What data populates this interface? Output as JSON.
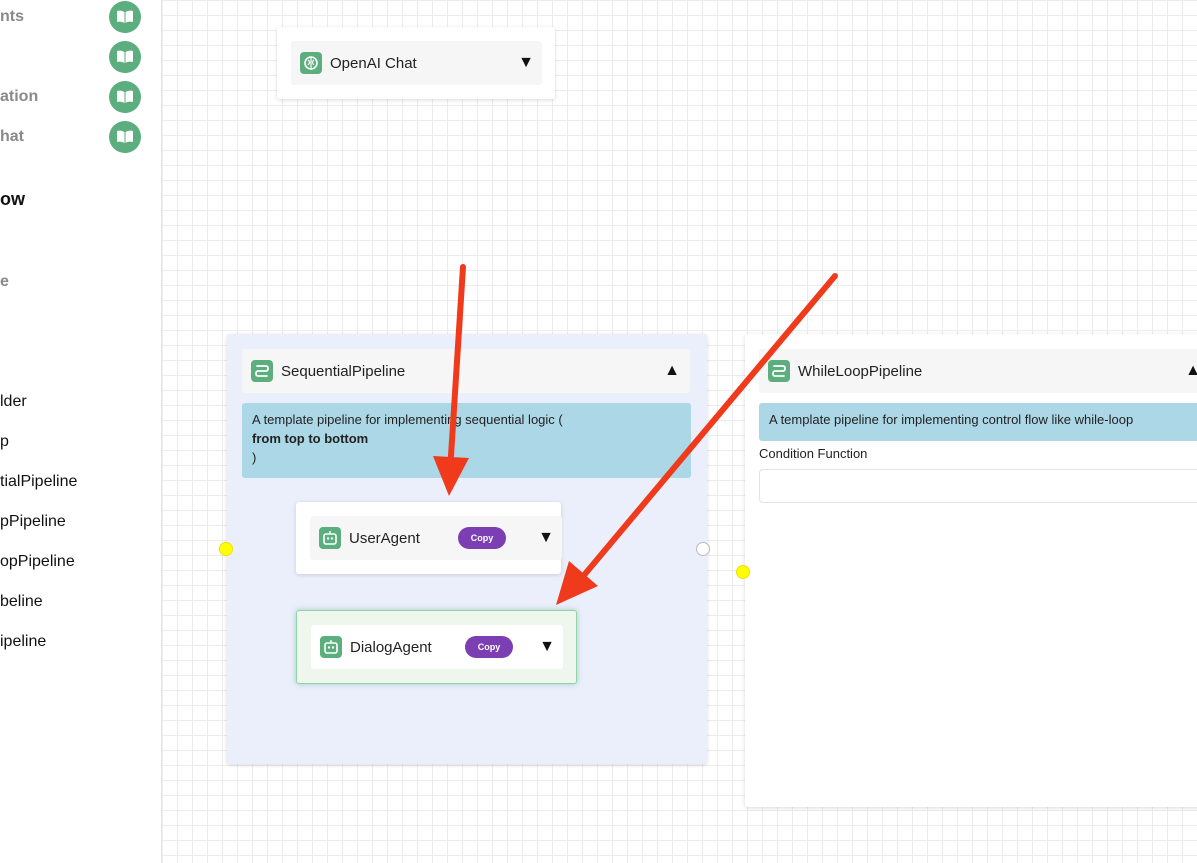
{
  "sidebar": {
    "book_items": [
      {
        "label": "nts"
      },
      {
        "label": ""
      },
      {
        "label": "ation"
      },
      {
        "label": "hat"
      }
    ],
    "section_title": "ow",
    "section_item": "e",
    "items": [
      {
        "label": "lder"
      },
      {
        "label": "p"
      },
      {
        "label": "tialPipeline"
      },
      {
        "label": "pPipeline"
      },
      {
        "label": "opPipeline"
      },
      {
        "label": "beline"
      },
      {
        "label": "ipeline"
      }
    ]
  },
  "canvas": {
    "openai_node": {
      "title": "OpenAI Chat",
      "toggle": "▼"
    },
    "sequential_node": {
      "title": "SequentialPipeline",
      "toggle": "▲",
      "description_line1": "A template pipeline for implementing sequential logic (",
      "description_bold": "from top to bottom",
      "description_line3": ")",
      "children": [
        {
          "title": "UserAgent",
          "copy_label": "Copy",
          "toggle": "▼"
        },
        {
          "title": "DialogAgent",
          "copy_label": "Copy",
          "toggle": "▼"
        }
      ]
    },
    "whileloop_node": {
      "title": "WhileLoopPipeline",
      "toggle": "▲",
      "description": "A template pipeline for implementing control flow like while-loop",
      "condition_label": "Condition Function",
      "condition_value": ""
    }
  },
  "colors": {
    "accent_green": "#5cae7f",
    "copy_purple": "#7b3fb3",
    "description_blue": "#acd7e6",
    "pipeline_bg": "#ebeffc",
    "selected_node_bg": "#eef6ee",
    "arrow_red": "#f03a1c",
    "handle_yellow": "#ffff00"
  }
}
